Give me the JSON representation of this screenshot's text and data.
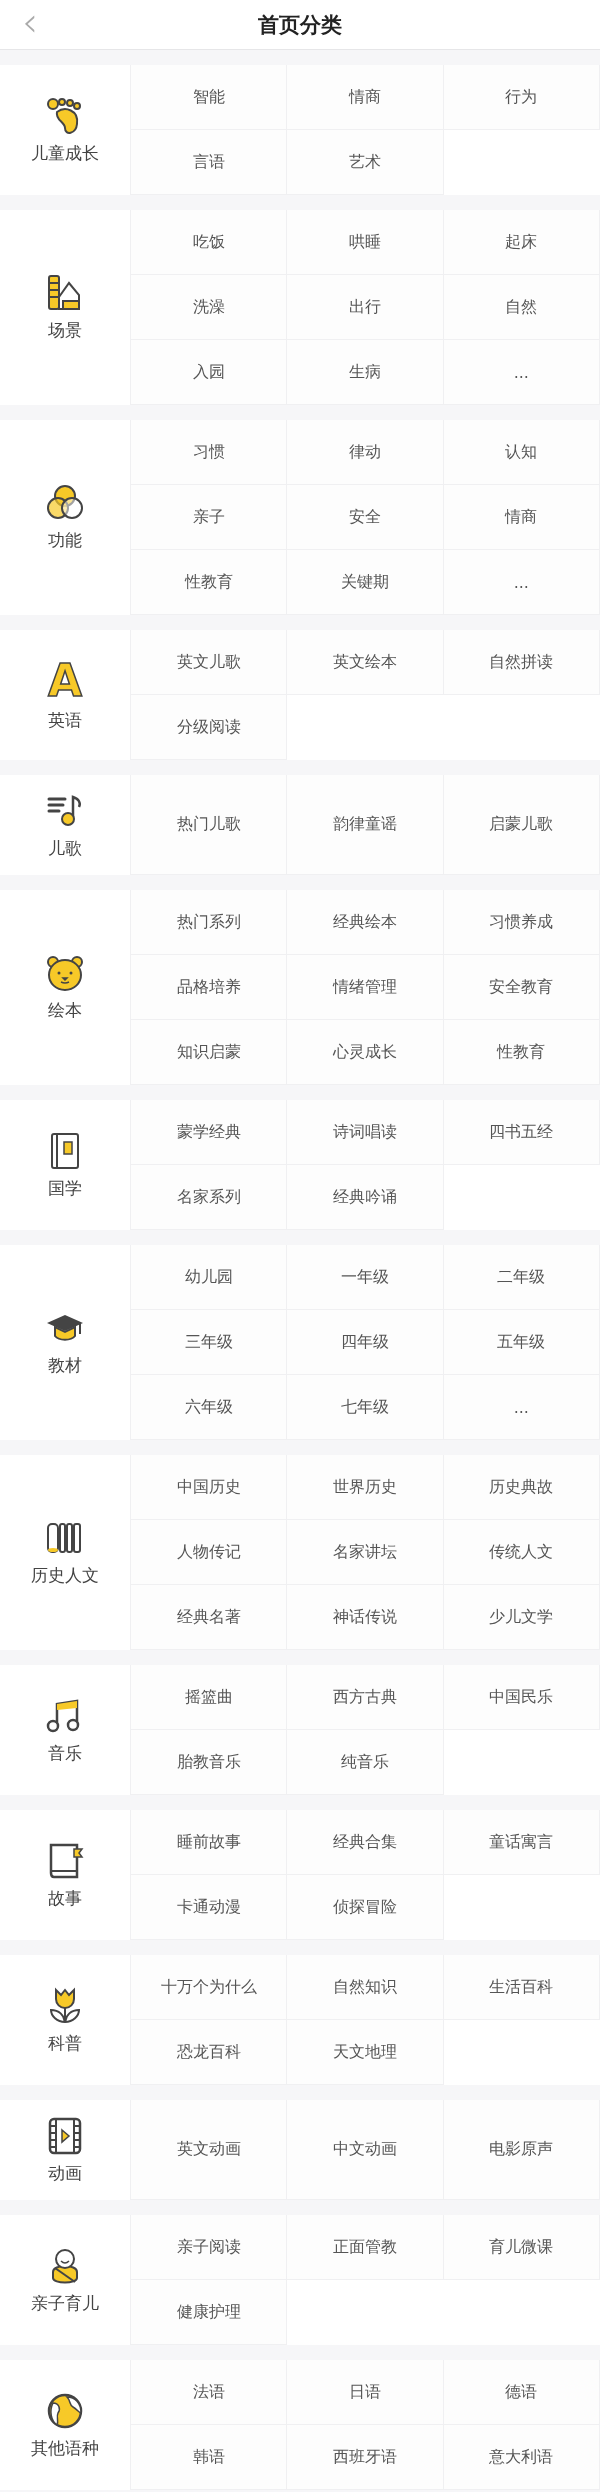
{
  "header": {
    "title": "首页分类",
    "back": "‹"
  },
  "sections": [
    {
      "label": "儿童成长",
      "items": [
        "智能",
        "情商",
        "行为",
        "言语",
        "艺术"
      ]
    },
    {
      "label": "场景",
      "items": [
        "吃饭",
        "哄睡",
        "起床",
        "洗澡",
        "出行",
        "自然",
        "入园",
        "生病",
        "..."
      ]
    },
    {
      "label": "功能",
      "items": [
        "习惯",
        "律动",
        "认知",
        "亲子",
        "安全",
        "情商",
        "性教育",
        "关键期",
        "..."
      ]
    },
    {
      "icon_text": "A",
      "label": "英语",
      "items": [
        "英文儿歌",
        "英文绘本",
        "自然拼读",
        "分级阅读"
      ]
    },
    {
      "label": "儿歌",
      "items": [
        "热门儿歌",
        "韵律童谣",
        "启蒙儿歌"
      ]
    },
    {
      "label": "绘本",
      "items": [
        "热门系列",
        "经典绘本",
        "习惯养成",
        "品格培养",
        "情绪管理",
        "安全教育",
        "知识启蒙",
        "心灵成长",
        "性教育"
      ]
    },
    {
      "label": "国学",
      "items": [
        "蒙学经典",
        "诗词唱读",
        "四书五经",
        "名家系列",
        "经典吟诵"
      ]
    },
    {
      "label": "教材",
      "items": [
        "幼儿园",
        "一年级",
        "二年级",
        "三年级",
        "四年级",
        "五年级",
        "六年级",
        "七年级",
        "..."
      ]
    },
    {
      "label": "历史人文",
      "items": [
        "中国历史",
        "世界历史",
        "历史典故",
        "人物传记",
        "名家讲坛",
        "传统人文",
        "经典名著",
        "神话传说",
        "少儿文学"
      ]
    },
    {
      "label": "音乐",
      "items": [
        "摇篮曲",
        "西方古典",
        "中国民乐",
        "胎教音乐",
        "纯音乐"
      ]
    },
    {
      "label": "故事",
      "items": [
        "睡前故事",
        "经典合集",
        "童话寓言",
        "卡通动漫",
        "侦探冒险"
      ]
    },
    {
      "label": "科普",
      "items": [
        "十万个为什么",
        "自然知识",
        "生活百科",
        "恐龙百科",
        "天文地理"
      ]
    },
    {
      "label": "动画",
      "items": [
        "英文动画",
        "中文动画",
        "电影原声"
      ]
    },
    {
      "label": "亲子育儿",
      "items": [
        "亲子阅读",
        "正面管教",
        "育儿微课",
        "健康护理"
      ]
    },
    {
      "label": "其他语种",
      "items": [
        "法语",
        "日语",
        "德语",
        "韩语",
        "西班牙语",
        "意大利语"
      ]
    }
  ]
}
